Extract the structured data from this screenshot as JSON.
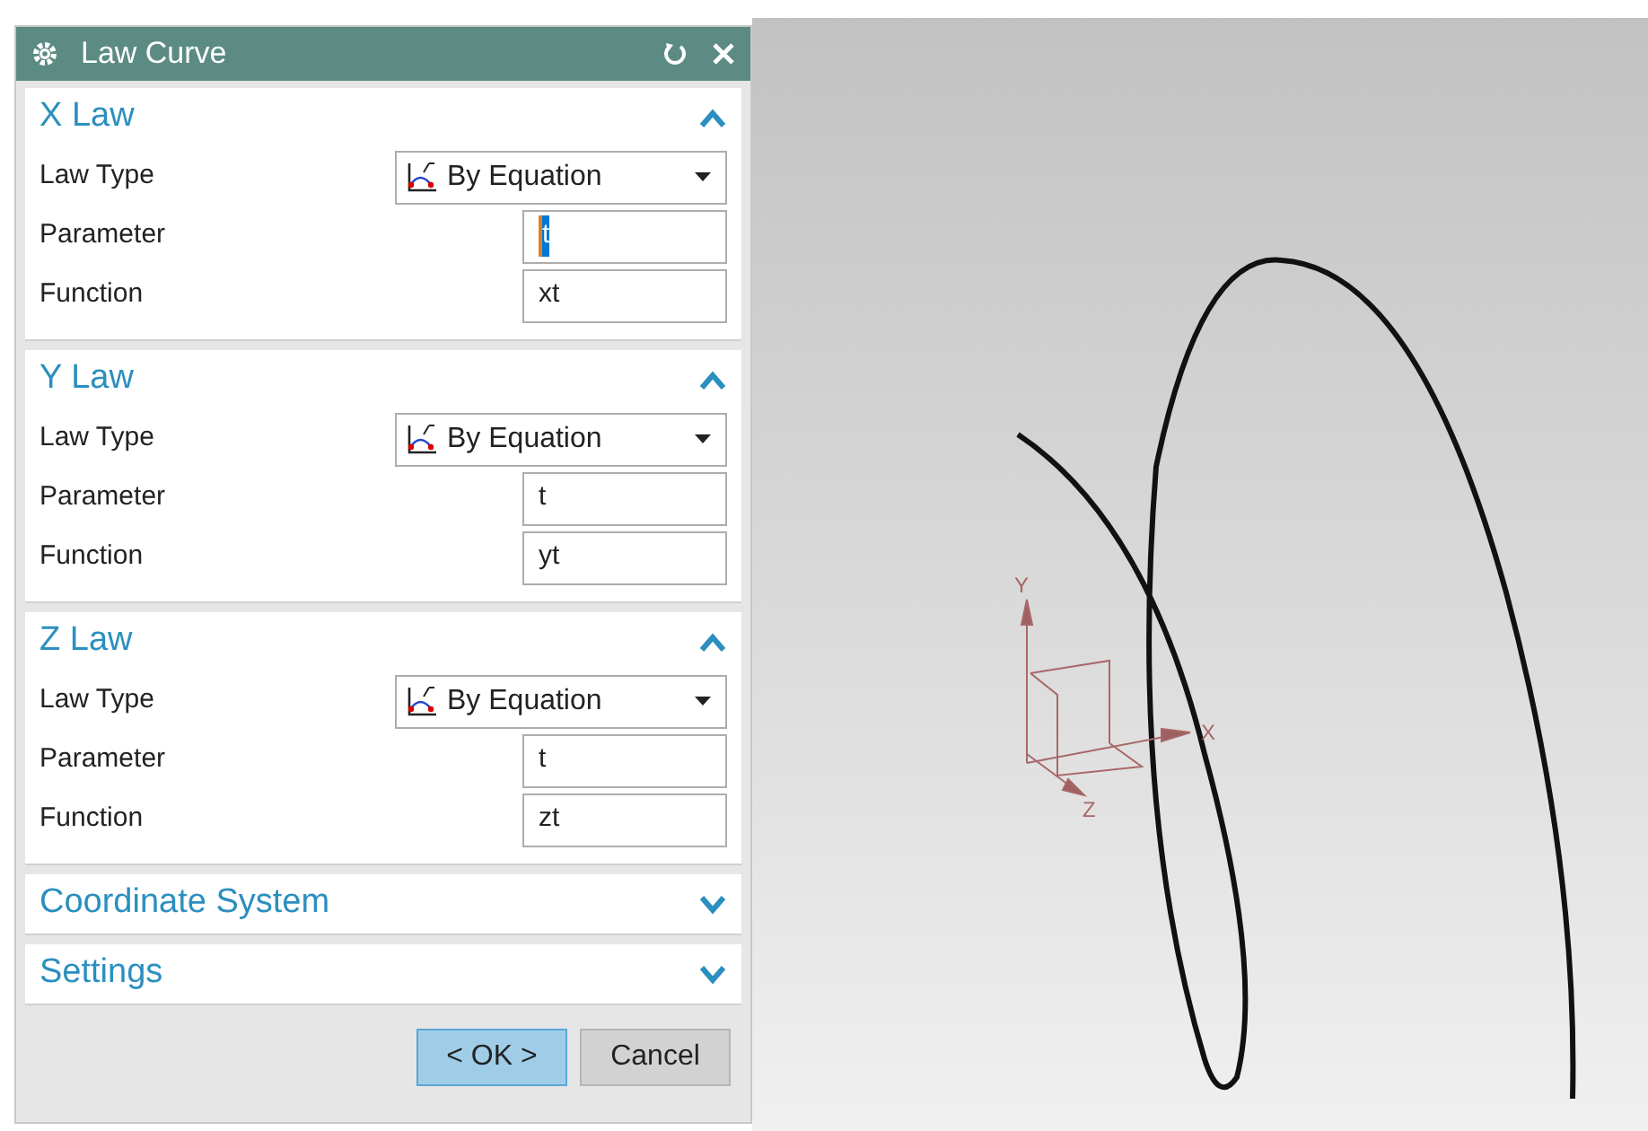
{
  "dialog": {
    "title": "Law Curve"
  },
  "sections": [
    {
      "title": "X Law",
      "expanded": true,
      "rows": [
        {
          "kind": "select",
          "label": "Law Type",
          "value": "By Equation"
        },
        {
          "kind": "input",
          "label": "Parameter",
          "value": "t",
          "highlighted": true
        },
        {
          "kind": "input",
          "label": "Function",
          "value": "xt",
          "highlighted": false
        }
      ]
    },
    {
      "title": "Y Law",
      "expanded": true,
      "rows": [
        {
          "kind": "select",
          "label": "Law Type",
          "value": "By Equation"
        },
        {
          "kind": "input",
          "label": "Parameter",
          "value": "t",
          "highlighted": false
        },
        {
          "kind": "input",
          "label": "Function",
          "value": "yt",
          "highlighted": false
        }
      ]
    },
    {
      "title": "Z Law",
      "expanded": true,
      "rows": [
        {
          "kind": "select",
          "label": "Law Type",
          "value": "By Equation"
        },
        {
          "kind": "input",
          "label": "Parameter",
          "value": "t",
          "highlighted": false
        },
        {
          "kind": "input",
          "label": "Function",
          "value": "zt",
          "highlighted": false
        }
      ]
    },
    {
      "title": "Coordinate System",
      "expanded": false
    },
    {
      "title": "Settings",
      "expanded": false
    }
  ],
  "buttons": [
    {
      "label": "< OK >",
      "primary": true
    },
    {
      "label": "Cancel",
      "primary": false
    }
  ],
  "viewport": {
    "axes": {
      "x": "X",
      "y": "Y",
      "z": "Z"
    }
  }
}
